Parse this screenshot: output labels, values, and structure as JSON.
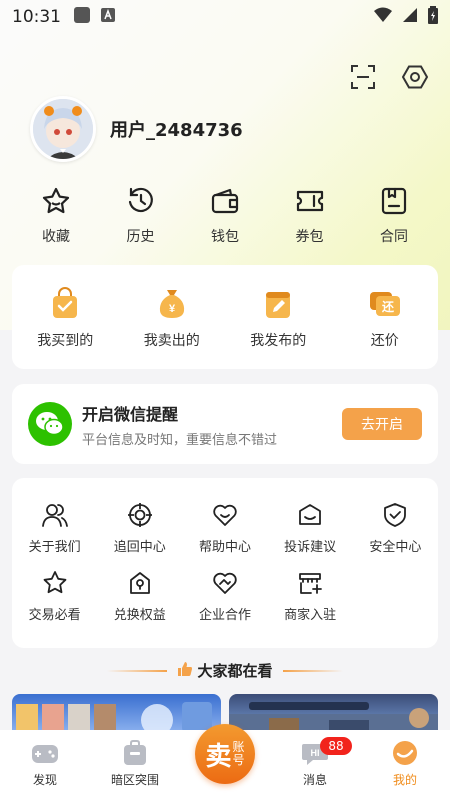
{
  "status_bar": {
    "time": "10:31"
  },
  "profile": {
    "username": "用户_2484736"
  },
  "top_icons": [
    "scan-icon",
    "settings-icon"
  ],
  "quick_links": [
    {
      "label": "收藏",
      "icon": "star-icon"
    },
    {
      "label": "历史",
      "icon": "history-icon"
    },
    {
      "label": "钱包",
      "icon": "wallet-icon"
    },
    {
      "label": "券包",
      "icon": "coupon-icon"
    },
    {
      "label": "合同",
      "icon": "contract-icon"
    }
  ],
  "orders": [
    {
      "label": "我买到的",
      "icon": "bought-bag-icon"
    },
    {
      "label": "我卖出的",
      "icon": "sold-money-bag-icon"
    },
    {
      "label": "我发布的",
      "icon": "published-edit-icon"
    },
    {
      "label": "还价",
      "icon": "counter-offer-icon"
    }
  ],
  "wechat": {
    "title": "开启微信提醒",
    "subtitle": "平台信息及时知，重要信息不错过",
    "button": "去开启"
  },
  "services": [
    {
      "label": "关于我们",
      "icon": "users-icon"
    },
    {
      "label": "追回中心",
      "icon": "target-icon"
    },
    {
      "label": "帮助中心",
      "icon": "heart-icon"
    },
    {
      "label": "投诉建议",
      "icon": "mail-smile-icon"
    },
    {
      "label": "安全中心",
      "icon": "shield-check-icon"
    },
    {
      "label": "交易必看",
      "icon": "star-outline-icon"
    },
    {
      "label": "兑换权益",
      "icon": "lock-exchange-icon"
    },
    {
      "label": "企业合作",
      "icon": "handshake-heart-icon"
    },
    {
      "label": "商家入驻",
      "icon": "store-add-icon"
    }
  ],
  "section": {
    "title": "大家都在看"
  },
  "bottom_nav": {
    "items": [
      {
        "label": "发现",
        "icon": "gamepad-icon"
      },
      {
        "label": "暗区突围",
        "icon": "backpack-icon"
      },
      {
        "label": "消息",
        "icon": "message-icon"
      },
      {
        "label": "我的",
        "icon": "profile-orange-icon"
      }
    ],
    "sell": {
      "big": "卖",
      "small_top": "账",
      "small_bottom": "号"
    },
    "message_badge": "88"
  },
  "colors": {
    "accent": "#f4a24a",
    "active": "#f08c1b",
    "wechat": "#2dc100",
    "badge": "#f2231c"
  }
}
